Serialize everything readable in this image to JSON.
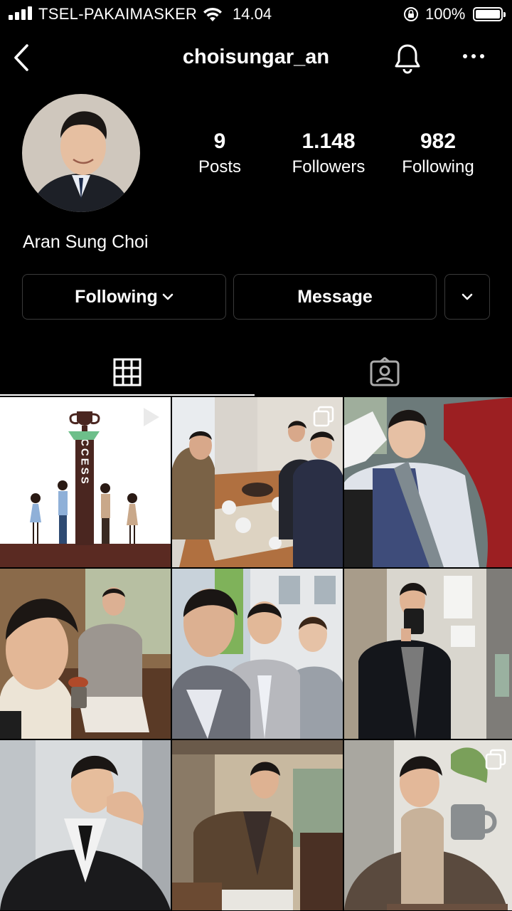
{
  "status_bar": {
    "carrier": "TSEL-PAKAIMASKER",
    "time": "14.04",
    "battery": "100%"
  },
  "header": {
    "username": "choisungar_an",
    "icons": [
      "back-arrow-icon",
      "bell-icon",
      "more-options-icon"
    ]
  },
  "profile": {
    "full_name": "Aran Sung Choi",
    "stats": [
      {
        "value": "9",
        "label": "Posts"
      },
      {
        "value": "1.148",
        "label": "Followers"
      },
      {
        "value": "982",
        "label": "Following"
      }
    ]
  },
  "actions": {
    "following_label": "Following",
    "message_label": "Message"
  },
  "tabs": [
    "grid-icon",
    "tagged-icon"
  ],
  "posts": [
    {
      "desc": "success illustration",
      "badge": "video-icon",
      "text": "SUCCESS"
    },
    {
      "desc": "dinner table",
      "badge": "carousel-icon"
    },
    {
      "desc": "car selfie",
      "badge": ""
    },
    {
      "desc": "restaurant selfie",
      "badge": ""
    },
    {
      "desc": "group selfie outdoors",
      "badge": ""
    },
    {
      "desc": "mirror selfie",
      "badge": ""
    },
    {
      "desc": "leather jacket portrait",
      "badge": ""
    },
    {
      "desc": "cafe portrait",
      "badge": ""
    },
    {
      "desc": "coffee cup portrait",
      "badge": "carousel-icon"
    }
  ],
  "colors": {
    "background": "#000000",
    "button_border": "#3a3a3a",
    "text": "#ffffff"
  }
}
